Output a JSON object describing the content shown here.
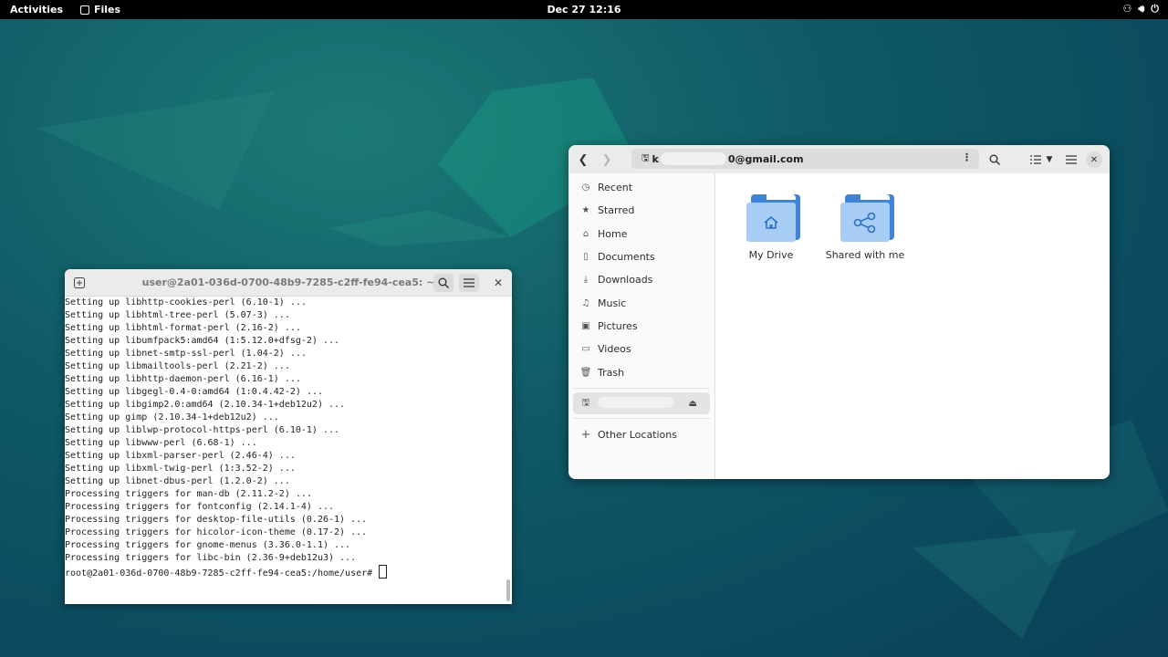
{
  "topbar": {
    "activities": "Activities",
    "app_name": "Files",
    "clock": "Dec 27  12:16"
  },
  "terminal": {
    "title": "user@2a01-036d-0700-48b9-7285-c2ff-fe94-cea5: ~",
    "lines": [
      "Setting up libhttp-cookies-perl (6.10-1) ...",
      "Setting up libhtml-tree-perl (5.07-3) ...",
      "Setting up libhtml-format-perl (2.16-2) ...",
      "Setting up libumfpack5:amd64 (1:5.12.0+dfsg-2) ...",
      "Setting up libnet-smtp-ssl-perl (1.04-2) ...",
      "Setting up libmailtools-perl (2.21-2) ...",
      "Setting up libhttp-daemon-perl (6.16-1) ...",
      "Setting up libgegl-0.4-0:amd64 (1:0.4.42-2) ...",
      "Setting up libgimp2.0:amd64 (2.10.34-1+deb12u2) ...",
      "Setting up gimp (2.10.34-1+deb12u2) ...",
      "Setting up liblwp-protocol-https-perl (6.10-1) ...",
      "Setting up libwww-perl (6.68-1) ...",
      "Setting up libxml-parser-perl (2.46-4) ...",
      "Setting up libxml-twig-perl (1:3.52-2) ...",
      "Setting up libnet-dbus-perl (1.2.0-2) ...",
      "Processing triggers for man-db (2.11.2-2) ...",
      "Processing triggers for fontconfig (2.14.1-4) ...",
      "Processing triggers for desktop-file-utils (0.26-1) ...",
      "Processing triggers for hicolor-icon-theme (0.17-2) ...",
      "Processing triggers for gnome-menus (3.36.0-1.1) ...",
      "Processing triggers for libc-bin (2.36-9+deb12u3) ..."
    ],
    "prompt": "root@2a01-036d-0700-48b9-7285-c2ff-fe94-cea5:/home/user# "
  },
  "files": {
    "path_prefix": "k",
    "path_suffix": "0@gmail.com",
    "sidebar": {
      "recent": "Recent",
      "starred": "Starred",
      "home": "Home",
      "documents": "Documents",
      "downloads": "Downloads",
      "music": "Music",
      "pictures": "Pictures",
      "videos": "Videos",
      "trash": "Trash",
      "other_locations": "Other Locations"
    },
    "folders": {
      "my_drive": "My Drive",
      "shared": "Shared with me"
    }
  }
}
